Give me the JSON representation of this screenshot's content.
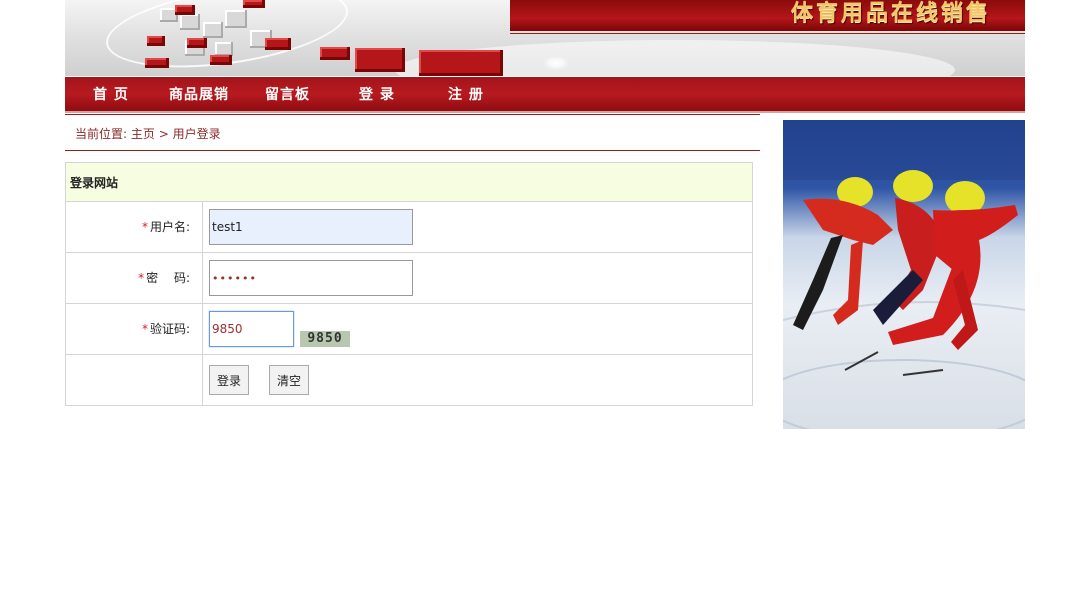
{
  "header": {
    "site_title": "体育用品在线销售"
  },
  "nav": {
    "items": [
      {
        "label": "首 页"
      },
      {
        "label": "商品展销"
      },
      {
        "label": "留言板"
      },
      {
        "label": "登 录"
      },
      {
        "label": "注 册"
      }
    ]
  },
  "breadcrumb": {
    "prefix": "当前位置:",
    "home": "主页",
    "separator": ">",
    "current": "用户登录"
  },
  "login": {
    "heading": "登录网站",
    "required_mark": "*",
    "username_label": "用户名:",
    "username_value": "test1",
    "password_label": "密　 码:",
    "password_display": "••••••",
    "captcha_label": "验证码:",
    "captcha_input_value": "9850",
    "captcha_image_text": "9850",
    "login_button": "登录",
    "clear_button": "清空"
  },
  "colors": {
    "brand_red": "#b5161a",
    "header_gold": "#f3c66a",
    "panel_head_bg": "#f7fde0"
  }
}
